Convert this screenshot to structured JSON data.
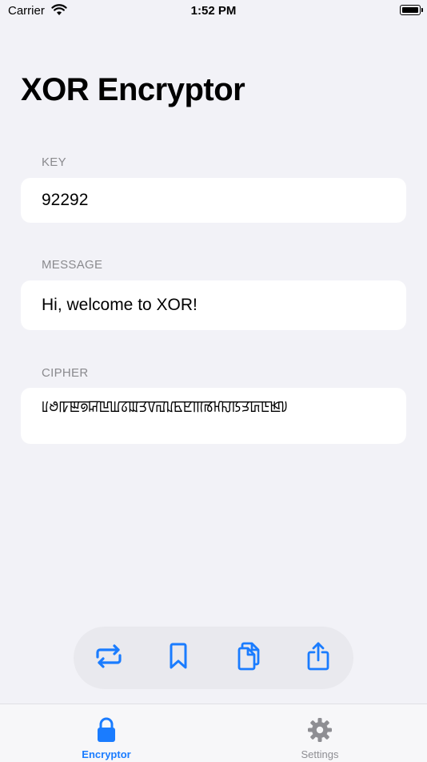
{
  "status_bar": {
    "carrier": "Carrier",
    "time": "1:52 PM"
  },
  "page": {
    "title": "XOR Encryptor"
  },
  "key_section": {
    "label": "KEY",
    "value": "92292"
  },
  "message_section": {
    "label": "MESSAGE",
    "value": "Hi, welcome to XOR!"
  },
  "cipher_section": {
    "label": "CIPHER",
    "value": "ꡦꢟꡠꡣꡟꡒꡖꡆꡞꡉꡗꡧꡌꡊꡥꡢꡕꡏꡘꡍꡑꡭꡚꡇꡓꡨ"
  },
  "toolbar": {
    "buttons": [
      "swap-icon",
      "bookmark-icon",
      "copy-icon",
      "share-icon"
    ]
  },
  "tab_bar": {
    "tabs": [
      {
        "label": "Encryptor",
        "icon": "lock-icon",
        "active": true
      },
      {
        "label": "Settings",
        "icon": "gear-icon",
        "active": false
      }
    ]
  },
  "colors": {
    "accent": "#1a7cff",
    "background": "#f2f2f7",
    "label": "#8a8a8e"
  }
}
